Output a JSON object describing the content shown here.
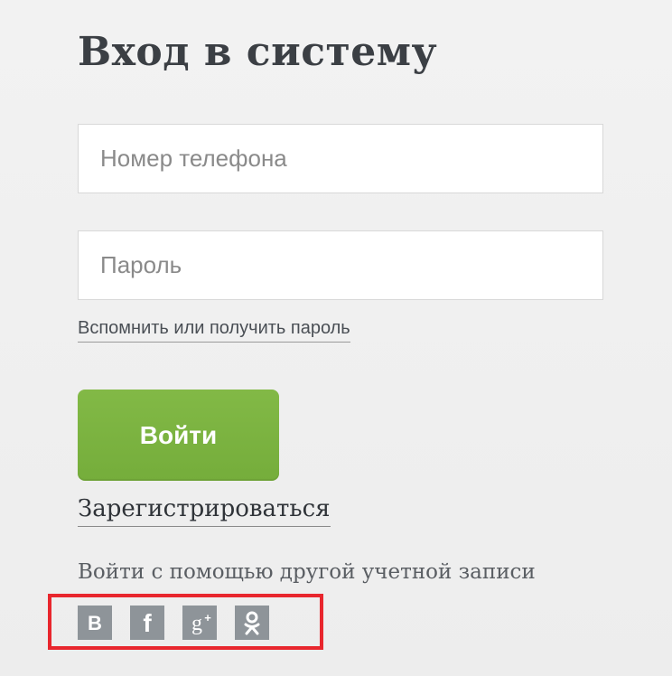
{
  "login": {
    "title": "Вход в систему",
    "phone_placeholder": "Номер телефона",
    "password_placeholder": "Пароль",
    "forgot_link": "Вспомнить или получить пароль",
    "submit_label": "Войти",
    "register_link": "Зарегистрироваться",
    "other_accounts_text": "Войти с помощью другой учетной записи"
  },
  "social": {
    "buttons": [
      {
        "icon": "vk-icon",
        "glyph": "B"
      },
      {
        "icon": "facebook-icon",
        "glyph": "f"
      },
      {
        "icon": "google-plus-icon",
        "glyph": "g+"
      },
      {
        "icon": "odnoklassniki-icon",
        "glyph": "ok"
      }
    ]
  },
  "colors": {
    "accent_green": "#7cb342",
    "highlight_red": "#e8262d",
    "social_gray": "#8e9499",
    "background": "#f0f0f0"
  }
}
